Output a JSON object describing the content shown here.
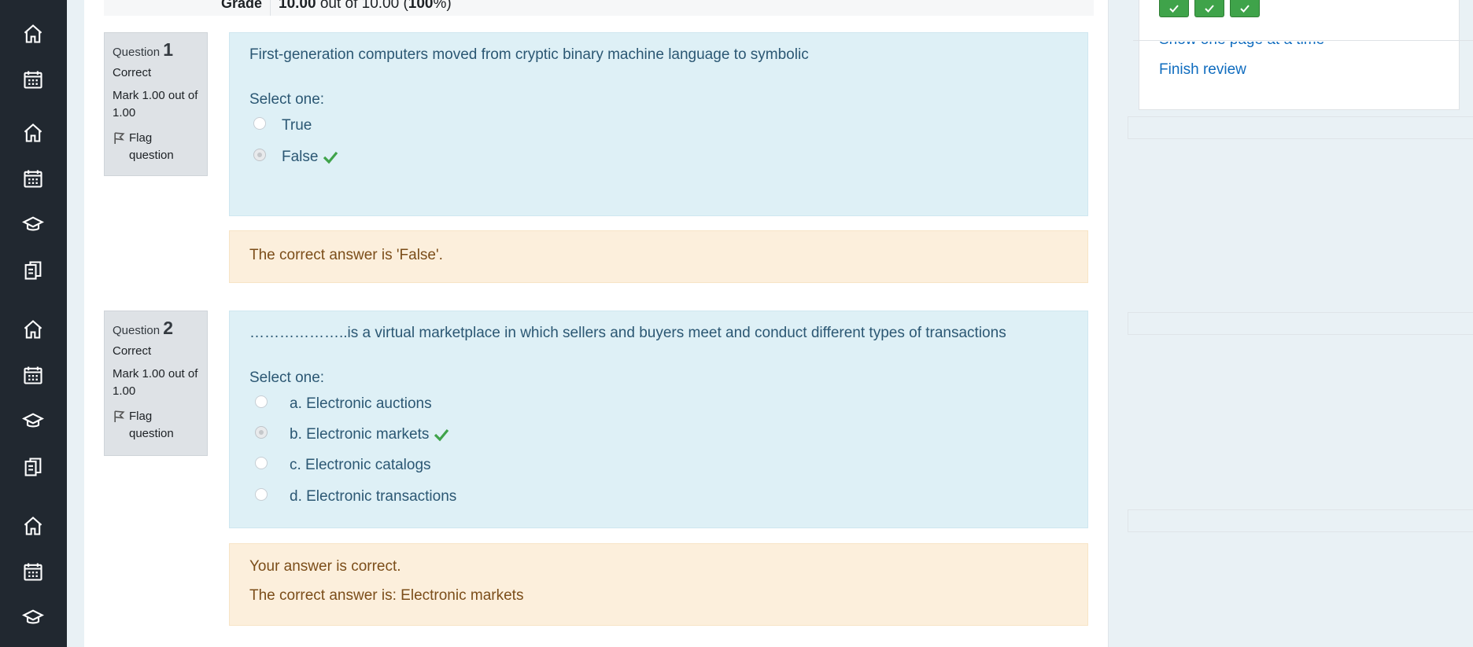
{
  "rail": {
    "icons": [
      "home-icon",
      "calendar-icon",
      "home-icon",
      "calendar-icon",
      "graduation-cap-icon",
      "copy-icon",
      "home-icon",
      "calendar-icon",
      "graduation-cap-icon",
      "copy-icon",
      "home-icon",
      "calendar-icon",
      "graduation-cap-icon"
    ]
  },
  "summary": {
    "grade_label": "Grade",
    "grade_score": "10.00",
    "grade_out_of": " out of 10.00 (",
    "grade_percent": "100",
    "grade_suffix": "%)"
  },
  "questions": [
    {
      "label": "Question ",
      "number": "1",
      "state": "Correct",
      "mark": "Mark 1.00 out of 1.00",
      "flag": "Flag question",
      "text": "First-generation computers moved from cryptic binary machine language to symbolic",
      "prompt": "Select one:",
      "options": [
        {
          "label": "True",
          "selected": false,
          "correct": false
        },
        {
          "label": "False",
          "selected": true,
          "correct": true
        }
      ],
      "feedback": [
        "The correct answer is 'False'."
      ]
    },
    {
      "label": "Question ",
      "number": "2",
      "state": "Correct",
      "mark": "Mark 1.00 out of 1.00",
      "flag": "Flag question",
      "text": "………………..is a virtual marketplace in which sellers and buyers meet and conduct different types of transactions",
      "prompt": "Select one:",
      "options": [
        {
          "label": "a. Electronic auctions",
          "selected": false,
          "correct": false
        },
        {
          "label": "b. Electronic markets",
          "selected": true,
          "correct": true
        },
        {
          "label": "c. Electronic catalogs",
          "selected": false,
          "correct": false
        },
        {
          "label": "d. Electronic transactions",
          "selected": false,
          "correct": false
        }
      ],
      "feedback": [
        "Your answer is correct.",
        "The correct answer is: Electronic markets"
      ]
    }
  ],
  "quiz_nav": {
    "buttons": [
      "correct",
      "correct",
      "correct"
    ],
    "show_one_page": "Show one page at a time",
    "finish_review": "Finish review"
  },
  "colors": {
    "rail": "#212830",
    "formulation": "#def0f6",
    "outcome": "#fcefdc",
    "correct": "#3fa34a",
    "link": "#0f6cbf"
  }
}
